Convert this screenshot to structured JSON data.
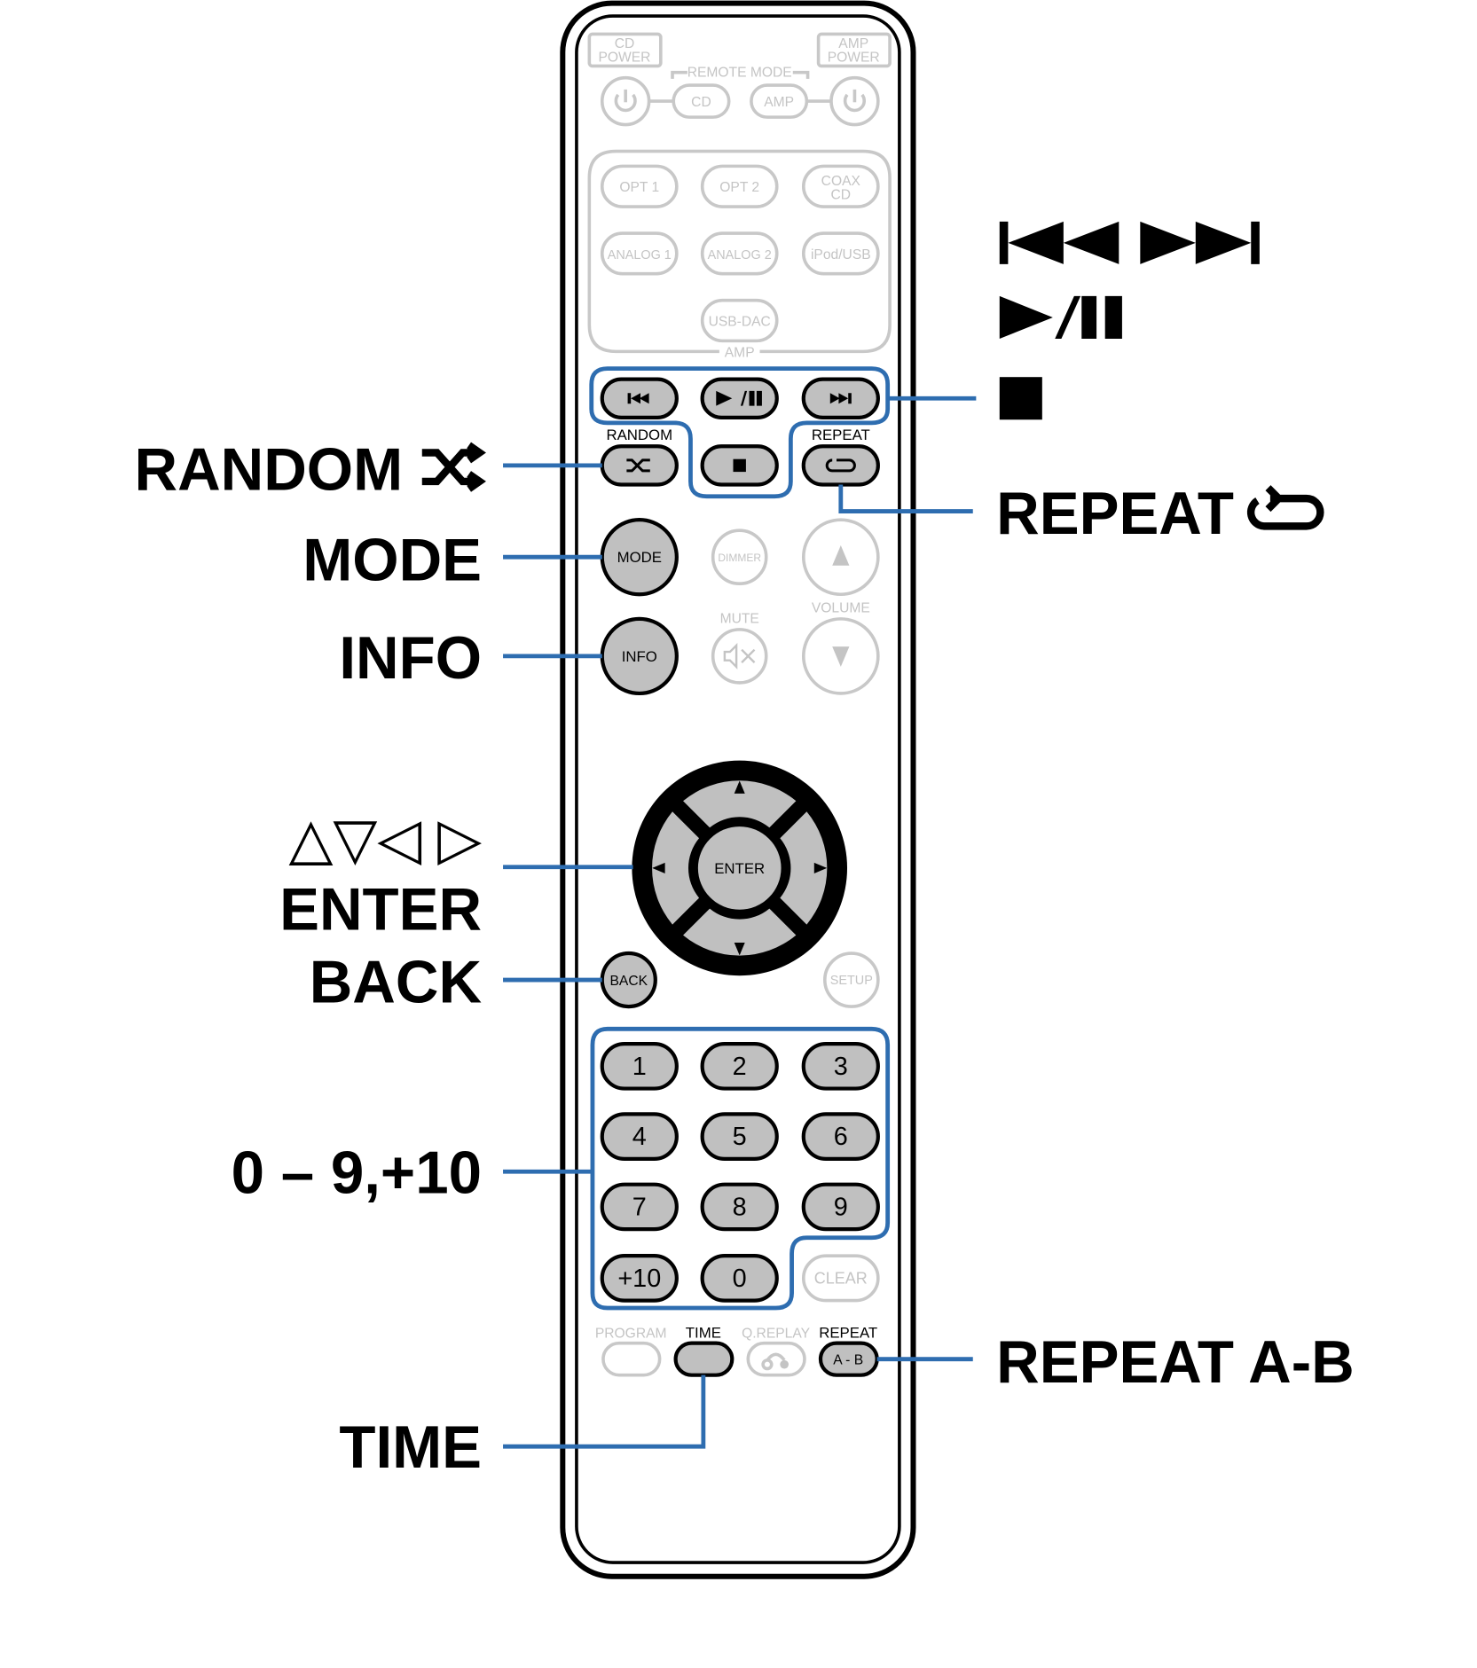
{
  "remote": {
    "cd_power": [
      "CD",
      "POWER"
    ],
    "amp_power": [
      "AMP",
      "POWER"
    ],
    "remote_mode": "REMOTE MODE",
    "remote_mode_cd": "CD",
    "remote_mode_amp": "AMP",
    "inputs": [
      "OPT 1",
      "OPT 2",
      "ANALOG 1",
      "ANALOG 2",
      "iPod/USB",
      "USB-DAC"
    ],
    "coax": [
      "COAX",
      "CD"
    ],
    "amp_group": "AMP",
    "random": "RANDOM",
    "repeat": "REPEAT",
    "mode": "MODE",
    "dimmer": "DIMMER",
    "volume": "VOLUME",
    "mute": "MUTE",
    "info": "INFO",
    "enter": "ENTER",
    "back": "BACK",
    "setup": "SETUP",
    "numbers": [
      "1",
      "2",
      "3",
      "4",
      "5",
      "6",
      "7",
      "8",
      "9",
      "+10",
      "0"
    ],
    "clear": "CLEAR",
    "program": "PROGRAM",
    "time": "TIME",
    "qreplay": "Q.REPLAY",
    "repeat_ab_top": "REPEAT",
    "repeat_ab": "A - B"
  },
  "callouts": {
    "random": "RANDOM",
    "mode": "MODE",
    "info": "INFO",
    "cursor_arrows": "△▽◁ ▷",
    "enter": "ENTER",
    "back": "BACK",
    "numbers": "0 – 9,+10",
    "time": "TIME",
    "repeat": "REPEAT",
    "repeat_ab": "REPEAT A-B"
  },
  "colors": {
    "callout_line": "#2e6db0",
    "active_button": "#c0c0c0",
    "inactive": "#c8c8c8"
  }
}
